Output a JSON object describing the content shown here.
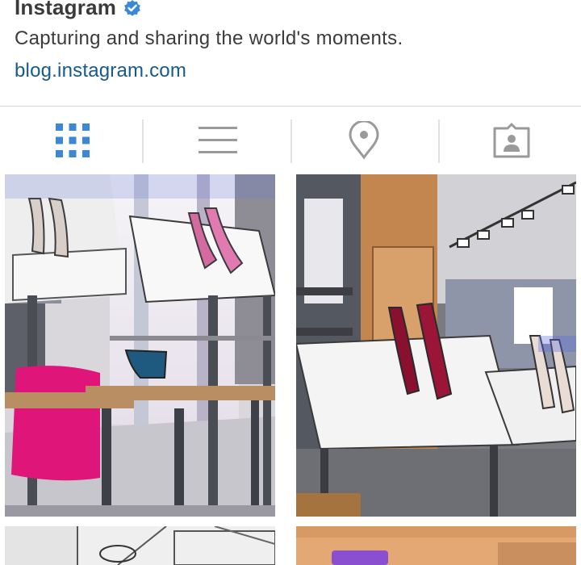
{
  "profile": {
    "name": "Instagram",
    "verified_icon": "verified-badge-icon",
    "bio": "Capturing and sharing the world's moments.",
    "website": "blog.instagram.com"
  },
  "tabs": [
    {
      "id": "grid",
      "icon": "grid-icon",
      "active": true
    },
    {
      "id": "list",
      "icon": "list-icon",
      "active": false
    },
    {
      "id": "places",
      "icon": "location-pin-icon",
      "active": false
    },
    {
      "id": "tagged",
      "icon": "tagged-person-icon",
      "active": false
    }
  ],
  "colors": {
    "active_tab": "#3b89d6",
    "inactive_tab": "#9a9a9a",
    "link": "#175b8a",
    "verified": "#3b89d6"
  },
  "posts": [
    {
      "id": "post-1",
      "description": "shoe store display"
    },
    {
      "id": "post-2",
      "description": "shoe store display"
    },
    {
      "id": "post-3",
      "description": "partial post"
    },
    {
      "id": "post-4",
      "description": "partial post"
    }
  ]
}
